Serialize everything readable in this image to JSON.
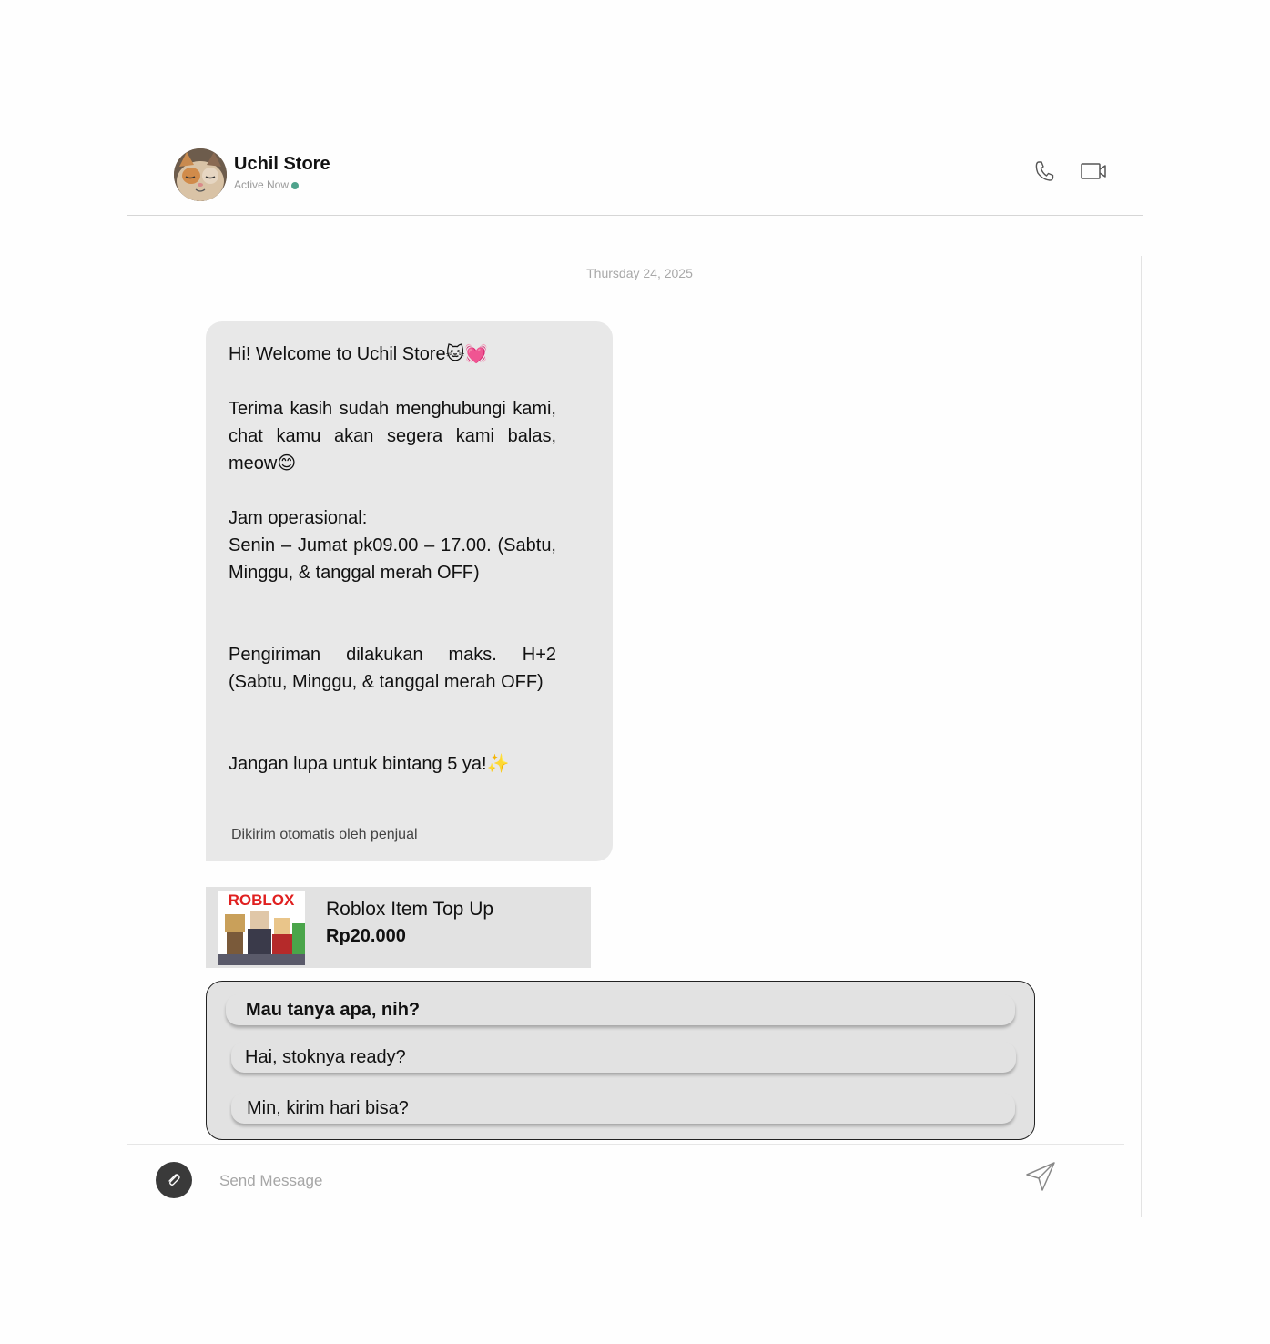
{
  "header": {
    "store_name": "Uchil Store",
    "status": "Active Now",
    "status_color": "#4fa38c",
    "call_icon": "phone-icon",
    "video_icon": "video-camera-icon"
  },
  "conversation": {
    "date": "Thursday 24, 2025",
    "welcome_message": {
      "line1": "Hi! Welcome to Uchil Store🐱💓",
      "line2": "Terima kasih sudah menghubungi kami, chat kamu akan segera kami balas, meow😊",
      "line3_title": "Jam operasional:",
      "line3_body": "Senin – Jumat pk09.00 – 17.00. (Sabtu, Minggu, & tanggal merah OFF)",
      "line4": "Pengiriman dilakukan maks. H+2 (Sabtu, Minggu, & tanggal merah OFF)",
      "line5": "Jangan lupa untuk bintang 5 ya!✨",
      "auto_note": "Dikirim otomatis oleh penjual"
    },
    "product": {
      "name": "Roblox Item Top Up",
      "price": "Rp20.000",
      "image_logo_text": "ROBLOX"
    },
    "quick_replies": {
      "title": "Mau tanya apa, nih?",
      "options": [
        "Hai, stoknya ready?",
        "Min, kirim hari bisa?"
      ]
    }
  },
  "composer": {
    "placeholder": "Send Message",
    "attach_icon": "paperclip-icon",
    "send_icon": "send-icon"
  }
}
